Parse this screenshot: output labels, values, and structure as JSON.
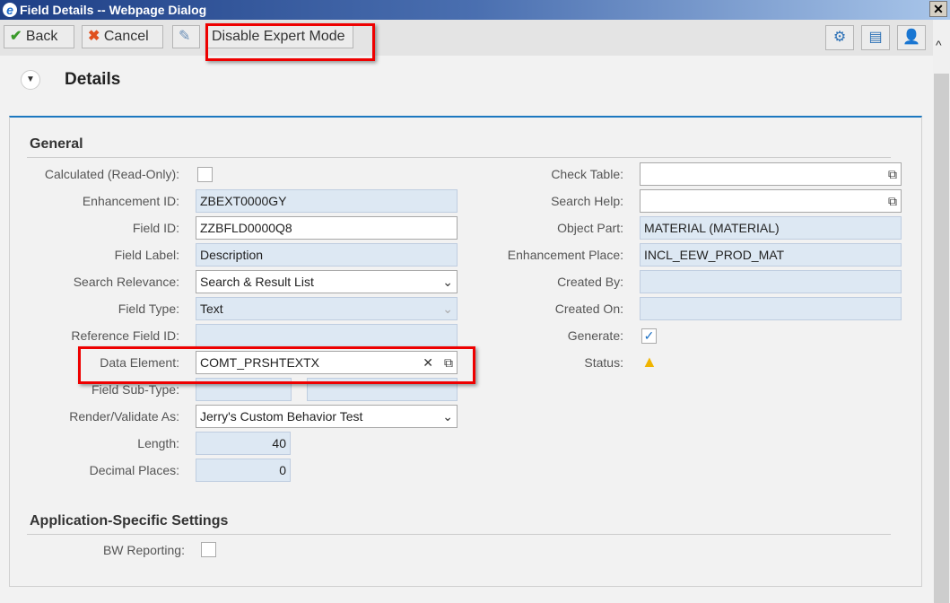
{
  "window": {
    "title": "Field Details -- Webpage Dialog",
    "close": "✕"
  },
  "toolbar": {
    "back": "Back",
    "cancel": "Cancel",
    "expert": "Disable Expert Mode"
  },
  "page": {
    "title": "Details"
  },
  "general": {
    "title": "General",
    "left": [
      {
        "label": "Calculated (Read-Only):",
        "type": "checkbox",
        "checked": false
      },
      {
        "label": "Enhancement ID:",
        "value": "ZBEXT0000GY",
        "type": "ro"
      },
      {
        "label": "Field ID:",
        "value": "ZZBFLD0000Q8",
        "type": "edit"
      },
      {
        "label": "Field Label:",
        "value": "Description",
        "type": "ro"
      },
      {
        "label": "Search Relevance:",
        "value": "Search & Result List",
        "type": "select"
      },
      {
        "label": "Field Type:",
        "value": "Text",
        "type": "ro-select"
      },
      {
        "label": "Reference Field ID:",
        "value": "",
        "type": "ro"
      },
      {
        "label": "Data Element:",
        "value": "COMT_PRSHTEXTX",
        "type": "valuehelp"
      },
      {
        "label": "Field Sub-Type:",
        "value": "",
        "type": "split"
      },
      {
        "label": "Render/Validate As:",
        "value": "Jerry's Custom Behavior Test",
        "type": "select"
      },
      {
        "label": "Length:",
        "value": "40",
        "type": "num"
      },
      {
        "label": "Decimal Places:",
        "value": "0",
        "type": "num"
      }
    ],
    "right": [
      {
        "label": "Check Table:",
        "value": "",
        "type": "help"
      },
      {
        "label": "Search Help:",
        "value": "",
        "type": "help"
      },
      {
        "label": "Object Part:",
        "value": "MATERIAL (MATERIAL)",
        "type": "ro"
      },
      {
        "label": "Enhancement Place:",
        "value": "INCL_EEW_PROD_MAT",
        "type": "ro"
      },
      {
        "label": "Created By:",
        "value": "",
        "type": "ro"
      },
      {
        "label": "Created On:",
        "value": "",
        "type": "ro"
      },
      {
        "label": "Generate:",
        "type": "checkbox",
        "checked": true
      },
      {
        "label": "Status:",
        "type": "warning"
      }
    ]
  },
  "app": {
    "title": "Application-Specific Settings",
    "bw_label": "BW Reporting:",
    "bw_checked": false
  }
}
